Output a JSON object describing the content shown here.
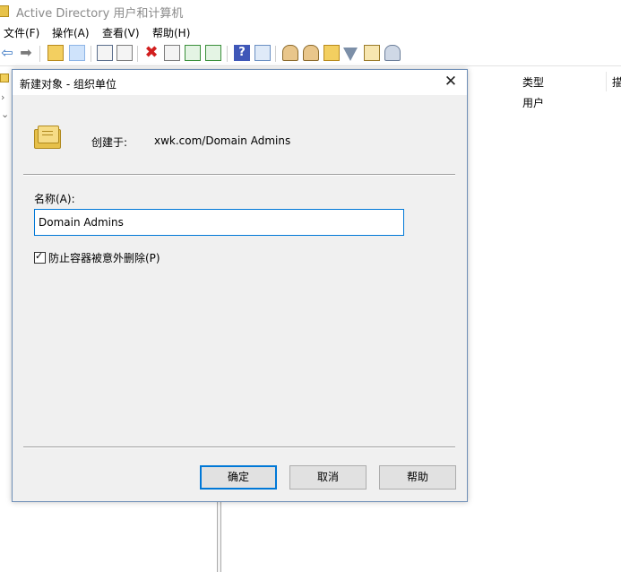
{
  "window": {
    "title": "Active Directory 用户和计算机"
  },
  "menu": [
    "文件(F)",
    "操作(A)",
    "查看(V)",
    "帮助(H)"
  ],
  "list": {
    "columns": [
      "类型",
      "描"
    ],
    "rows": [
      {
        "type": "用户"
      }
    ]
  },
  "dialog": {
    "title": "新建对象 - 组织单位",
    "close_glyph": "✕",
    "created_in_label": "创建于:",
    "created_in_value": "xwk.com/Domain Admins",
    "name_label": "名称(A):",
    "name_value": "Domain Admins",
    "protect": {
      "label": "防止容器被意外删除(P)",
      "checked": true,
      "glyph": "✓"
    },
    "buttons": {
      "ok": "确定",
      "cancel": "取消",
      "help": "帮助"
    }
  },
  "toolbar": {
    "icons": [
      "back-arrow-icon",
      "forward-arrow-icon",
      "up-folder-icon",
      "show-tree-icon",
      "cut-icon",
      "copy-icon",
      "delete-icon",
      "properties-icon",
      "refresh-icon",
      "export-icon",
      "help-icon",
      "console-view-icon",
      "new-user-icon",
      "new-group-icon",
      "new-ou-icon",
      "filter-icon",
      "find-icon",
      "users-icon"
    ],
    "back_glyph": "⇦",
    "forward_glyph": "➡",
    "delete_glyph": "✖",
    "help_glyph": "?"
  }
}
